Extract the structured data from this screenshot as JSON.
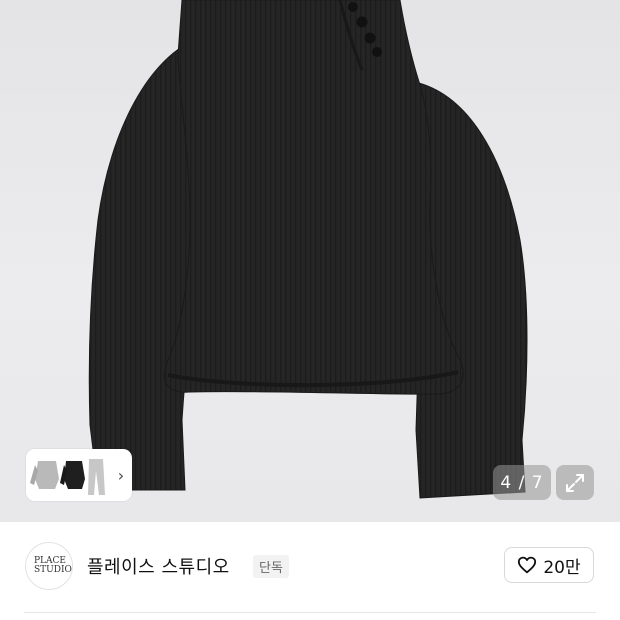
{
  "gallery": {
    "counter": "4 / 7",
    "expand_icon": "expand-arrows-icon",
    "thumbnail_chevron": "›"
  },
  "seller": {
    "logo_text": "PLACE STUDIO",
    "name": "플레이스 스튜디오",
    "badge": "단독",
    "like_count": "20만",
    "like_icon": "heart-outline-icon"
  },
  "colors": {
    "background": "#ebebed",
    "garment": "#242424",
    "accent_text": "#111111"
  }
}
